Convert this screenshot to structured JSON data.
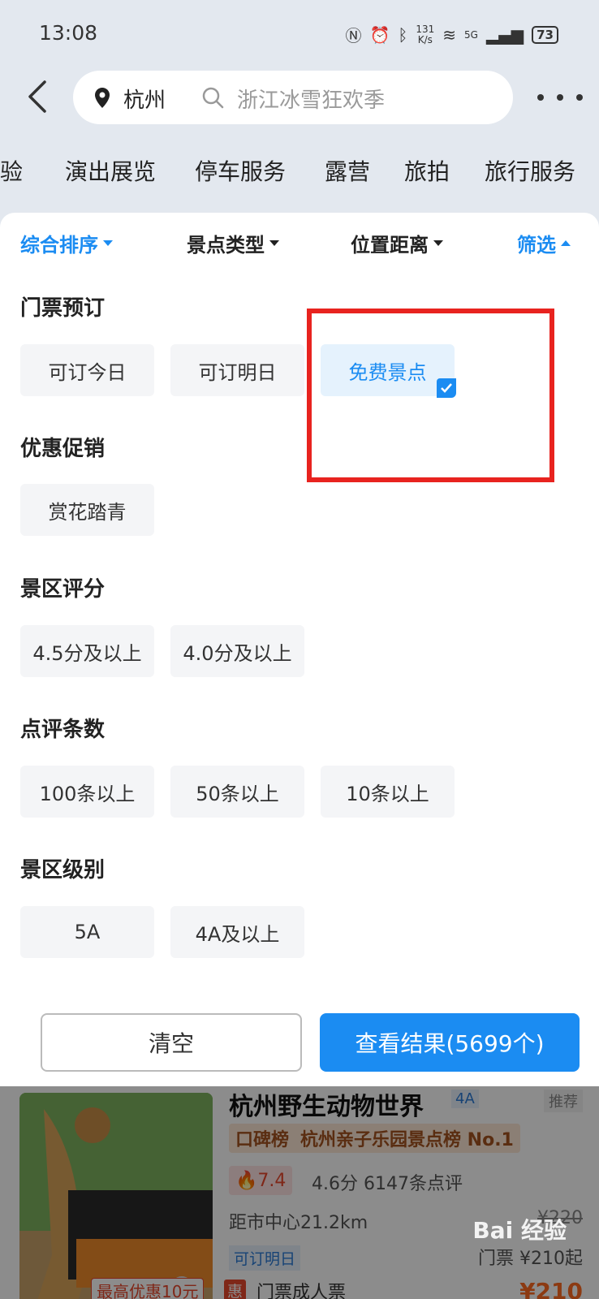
{
  "status": {
    "time": "13:08",
    "speed_value": "131",
    "speed_unit": "K/s",
    "network": "5G",
    "battery": "73"
  },
  "header": {
    "city": "杭州",
    "search_placeholder": "浙江冰雪狂欢季"
  },
  "categories": [
    "体验",
    "演出展览",
    "停车服务",
    "露营",
    "旅拍",
    "旅行服务"
  ],
  "sort_bar": {
    "items": [
      "综合排序",
      "景点类型",
      "位置距离",
      "筛选"
    ]
  },
  "sections": [
    {
      "title": "门票预订",
      "options": [
        "可订今日",
        "可订明日",
        "免费景点"
      ]
    },
    {
      "title": "优惠促销",
      "options": [
        "赏花踏青"
      ]
    },
    {
      "title": "景区评分",
      "options": [
        "4.5分及以上",
        "4.0分及以上"
      ]
    },
    {
      "title": "点评条数",
      "options": [
        "100条以上",
        "50条以上",
        "10条以上"
      ]
    },
    {
      "title": "景区级别",
      "options": [
        "5A",
        "4A及以上"
      ]
    }
  ],
  "footer": {
    "clear": "清空",
    "view_results": "查看结果(5699个)"
  },
  "card": {
    "title": "杭州野生动物世界",
    "level": "4A",
    "tag": "推荐",
    "rank_label": "口碑榜",
    "rank_text": "杭州亲子乐园景点榜 No.1",
    "hot": "7.4",
    "score": "4.6分",
    "reviews": "6147条点评",
    "distance": "距市中心21.2km",
    "orig_price": "¥220",
    "bookable": "可订明日",
    "price_label": "门票 ¥210起",
    "promo": "最高优惠10元",
    "deal": "惠",
    "ticket": "门票成人票",
    "price2": "¥210",
    "watermark": "Bai 经验"
  },
  "colors": {
    "accent": "#1b8cf2",
    "highlight": "#e8231f",
    "selected_bg": "#e5f2fd"
  }
}
